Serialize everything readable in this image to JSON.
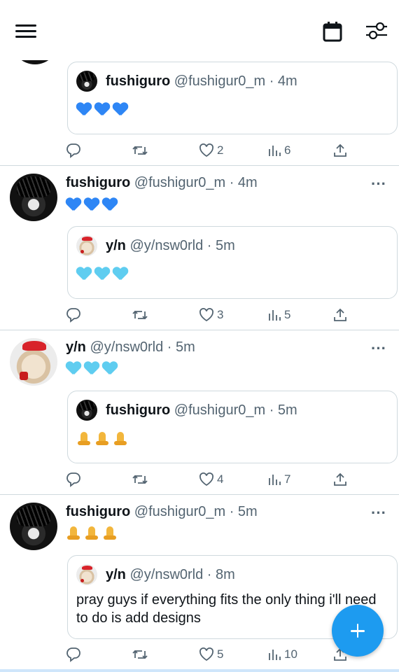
{
  "colors": {
    "accent": "#1d9bf0",
    "text": "#0f1419",
    "muted": "#536471",
    "blue_heart": "#2e86f5",
    "light_blue_heart": "#5fcdf0"
  },
  "header": {
    "menu_icon": "hamburger-icon",
    "calendar_icon": "calendar-icon",
    "filter_icon": "sliders-icon"
  },
  "posts": [
    {
      "quote": {
        "name": "fushiguro",
        "meta": "@fushigur0_m · 4m",
        "emoji": "💙💙💙"
      },
      "actions": {
        "likes": "2",
        "views": "6"
      }
    },
    {
      "name": "fushiguro",
      "meta": "@fushigur0_m · 4m",
      "emoji": "💙💙💙",
      "quote": {
        "name": "y/n",
        "meta": "@y/nsw0rld · 5m",
        "emoji": "🩵🩵🩵"
      },
      "actions": {
        "likes": "3",
        "views": "5"
      }
    },
    {
      "name": "y/n",
      "meta": "@y/nsw0rld · 5m",
      "emoji": "🩵🩵🩵",
      "quote": {
        "name": "fushiguro",
        "meta": "@fushigur0_m · 5m",
        "emoji": "🙏🙏🙏"
      },
      "actions": {
        "likes": "4",
        "views": "7"
      }
    },
    {
      "name": "fushiguro",
      "meta": "@fushigur0_m · 5m",
      "emoji": "🙏🙏🙏",
      "quote": {
        "name": "y/n",
        "meta": "@y/nsw0rld · 8m",
        "text": "pray guys if everything fits the only thing i'll need to do is add designs"
      },
      "actions": {
        "likes": "5",
        "views": "10"
      }
    }
  ],
  "fab": {
    "icon": "plus-icon"
  }
}
